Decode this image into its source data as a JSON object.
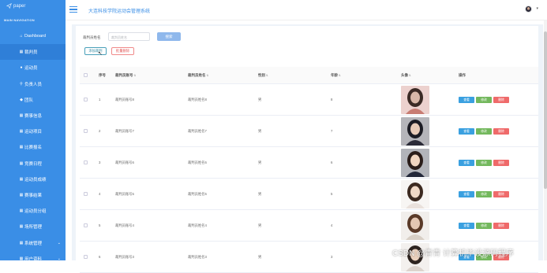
{
  "brand": {
    "logo_text": "paper",
    "nav_title": "MAIN NAVIGATION"
  },
  "sidebar": {
    "items": [
      {
        "label": "Dashboard",
        "icon": "home-icon"
      },
      {
        "label": "裁判员",
        "icon": "grid-icon",
        "active": true
      },
      {
        "label": "运动员",
        "icon": "user-icon"
      },
      {
        "label": "负责人员",
        "icon": "location-icon"
      },
      {
        "label": "团队",
        "icon": "team-icon"
      },
      {
        "label": "赛事信息",
        "icon": "grid-icon"
      },
      {
        "label": "运动项目",
        "icon": "grid-icon"
      },
      {
        "label": "比赛报名",
        "icon": "grid-icon"
      },
      {
        "label": "竞赛日程",
        "icon": "grid-icon"
      },
      {
        "label": "运动员成绩",
        "icon": "grid-icon"
      },
      {
        "label": "赛事结果",
        "icon": "grid-icon"
      },
      {
        "label": "运动员分组",
        "icon": "grid-icon"
      },
      {
        "label": "场所管理",
        "icon": "grid-icon"
      },
      {
        "label": "系统管理",
        "icon": "grid-icon",
        "chevron": "chevron-down-icon"
      },
      {
        "label": "用户资料",
        "icon": "grid-icon",
        "chevron": "chevron-down-icon"
      }
    ]
  },
  "header": {
    "title": "大连科技学院运动会管理系统"
  },
  "toolbar": {
    "search_label": "裁判员姓名",
    "search_placeholder": "裁判员姓名",
    "search_button": "搜索",
    "add_button": "添加裁判",
    "batch_delete_button": "批量删除"
  },
  "table": {
    "columns": [
      "序号",
      "裁判员账号",
      "裁判员姓名",
      "性别",
      "年龄",
      "头像",
      "操作"
    ],
    "rows": [
      {
        "no": "1",
        "account": "裁判员账号8",
        "name": "裁判员姓名8",
        "sex": "男",
        "age": "8"
      },
      {
        "no": "2",
        "account": "裁判员账号7",
        "name": "裁判员姓名7",
        "sex": "男",
        "age": "7"
      },
      {
        "no": "3",
        "account": "裁判员账号6",
        "name": "裁判员姓名6",
        "sex": "男",
        "age": "6"
      },
      {
        "no": "4",
        "account": "裁判员账号5",
        "name": "裁判员姓名5",
        "sex": "男",
        "age": "5"
      },
      {
        "no": "5",
        "account": "裁判员账号4",
        "name": "裁判员姓名4",
        "sex": "男",
        "age": "4"
      },
      {
        "no": "6",
        "account": "裁判员账号3",
        "name": "裁判员姓名3",
        "sex": "男",
        "age": "3"
      }
    ],
    "actions": {
      "view": "查看",
      "edit": "修改",
      "delete": "删除"
    }
  },
  "watermark": "CSDN @青青  计算机毕设源码程序",
  "colors": {
    "sidebar": "#3a8ee6",
    "view": "#3aa0e0",
    "edit": "#73b85d",
    "delete": "#ef6a6a"
  }
}
